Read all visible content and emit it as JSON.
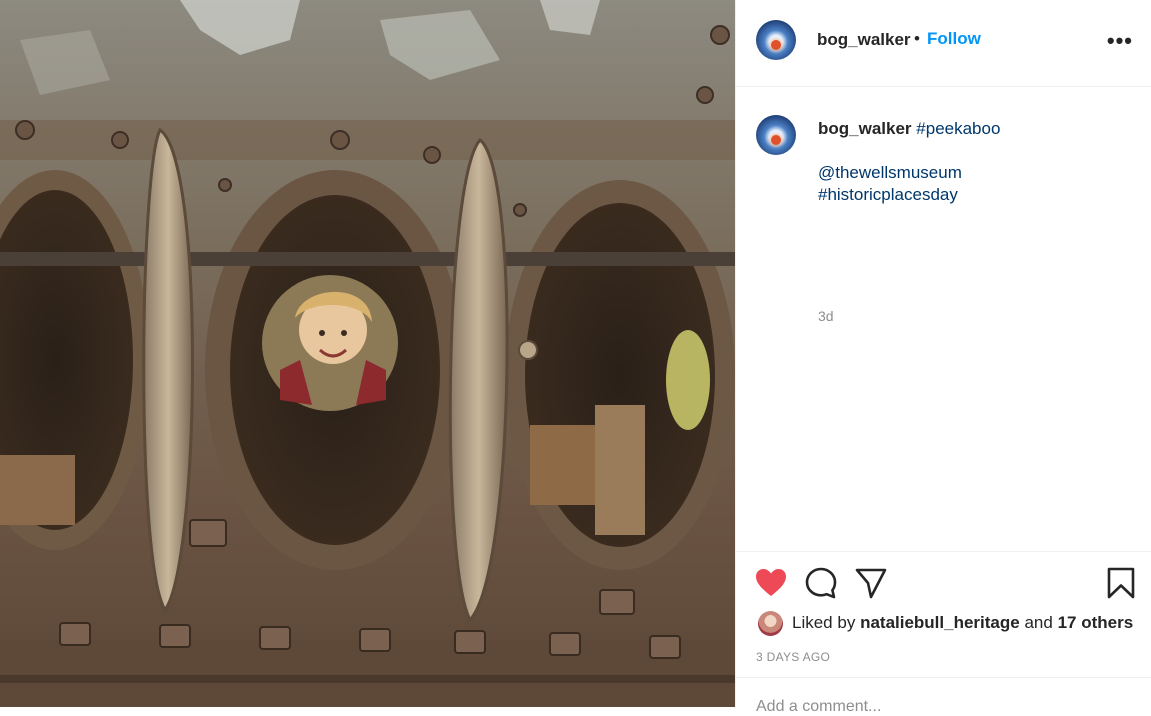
{
  "post": {
    "username": "bog_walker",
    "separator": "•",
    "follow_label": "Follow",
    "more_label": "•••",
    "photo_alt": "post-photo"
  },
  "caption": {
    "username": "bog_walker",
    "hashtag1": "#peekaboo",
    "mention": "@thewellsmuseum",
    "hashtag2": "#historicplacesday",
    "time": "3d"
  },
  "actions": {
    "liked": true,
    "like_icon": "heart-filled-icon",
    "comment_icon": "comment-icon",
    "share_icon": "paper-plane-icon",
    "save_icon": "bookmark-icon"
  },
  "likes": {
    "prefix": "Liked by",
    "user": "nataliebull_heritage",
    "and": "and",
    "others": "17 others"
  },
  "post_date": "3 DAYS AGO",
  "comment": {
    "placeholder": "Add a comment..."
  },
  "colors": {
    "accent": "#0095f6",
    "heart": "#ed4956",
    "tag": "#00376b",
    "muted": "#8e8e8e"
  }
}
